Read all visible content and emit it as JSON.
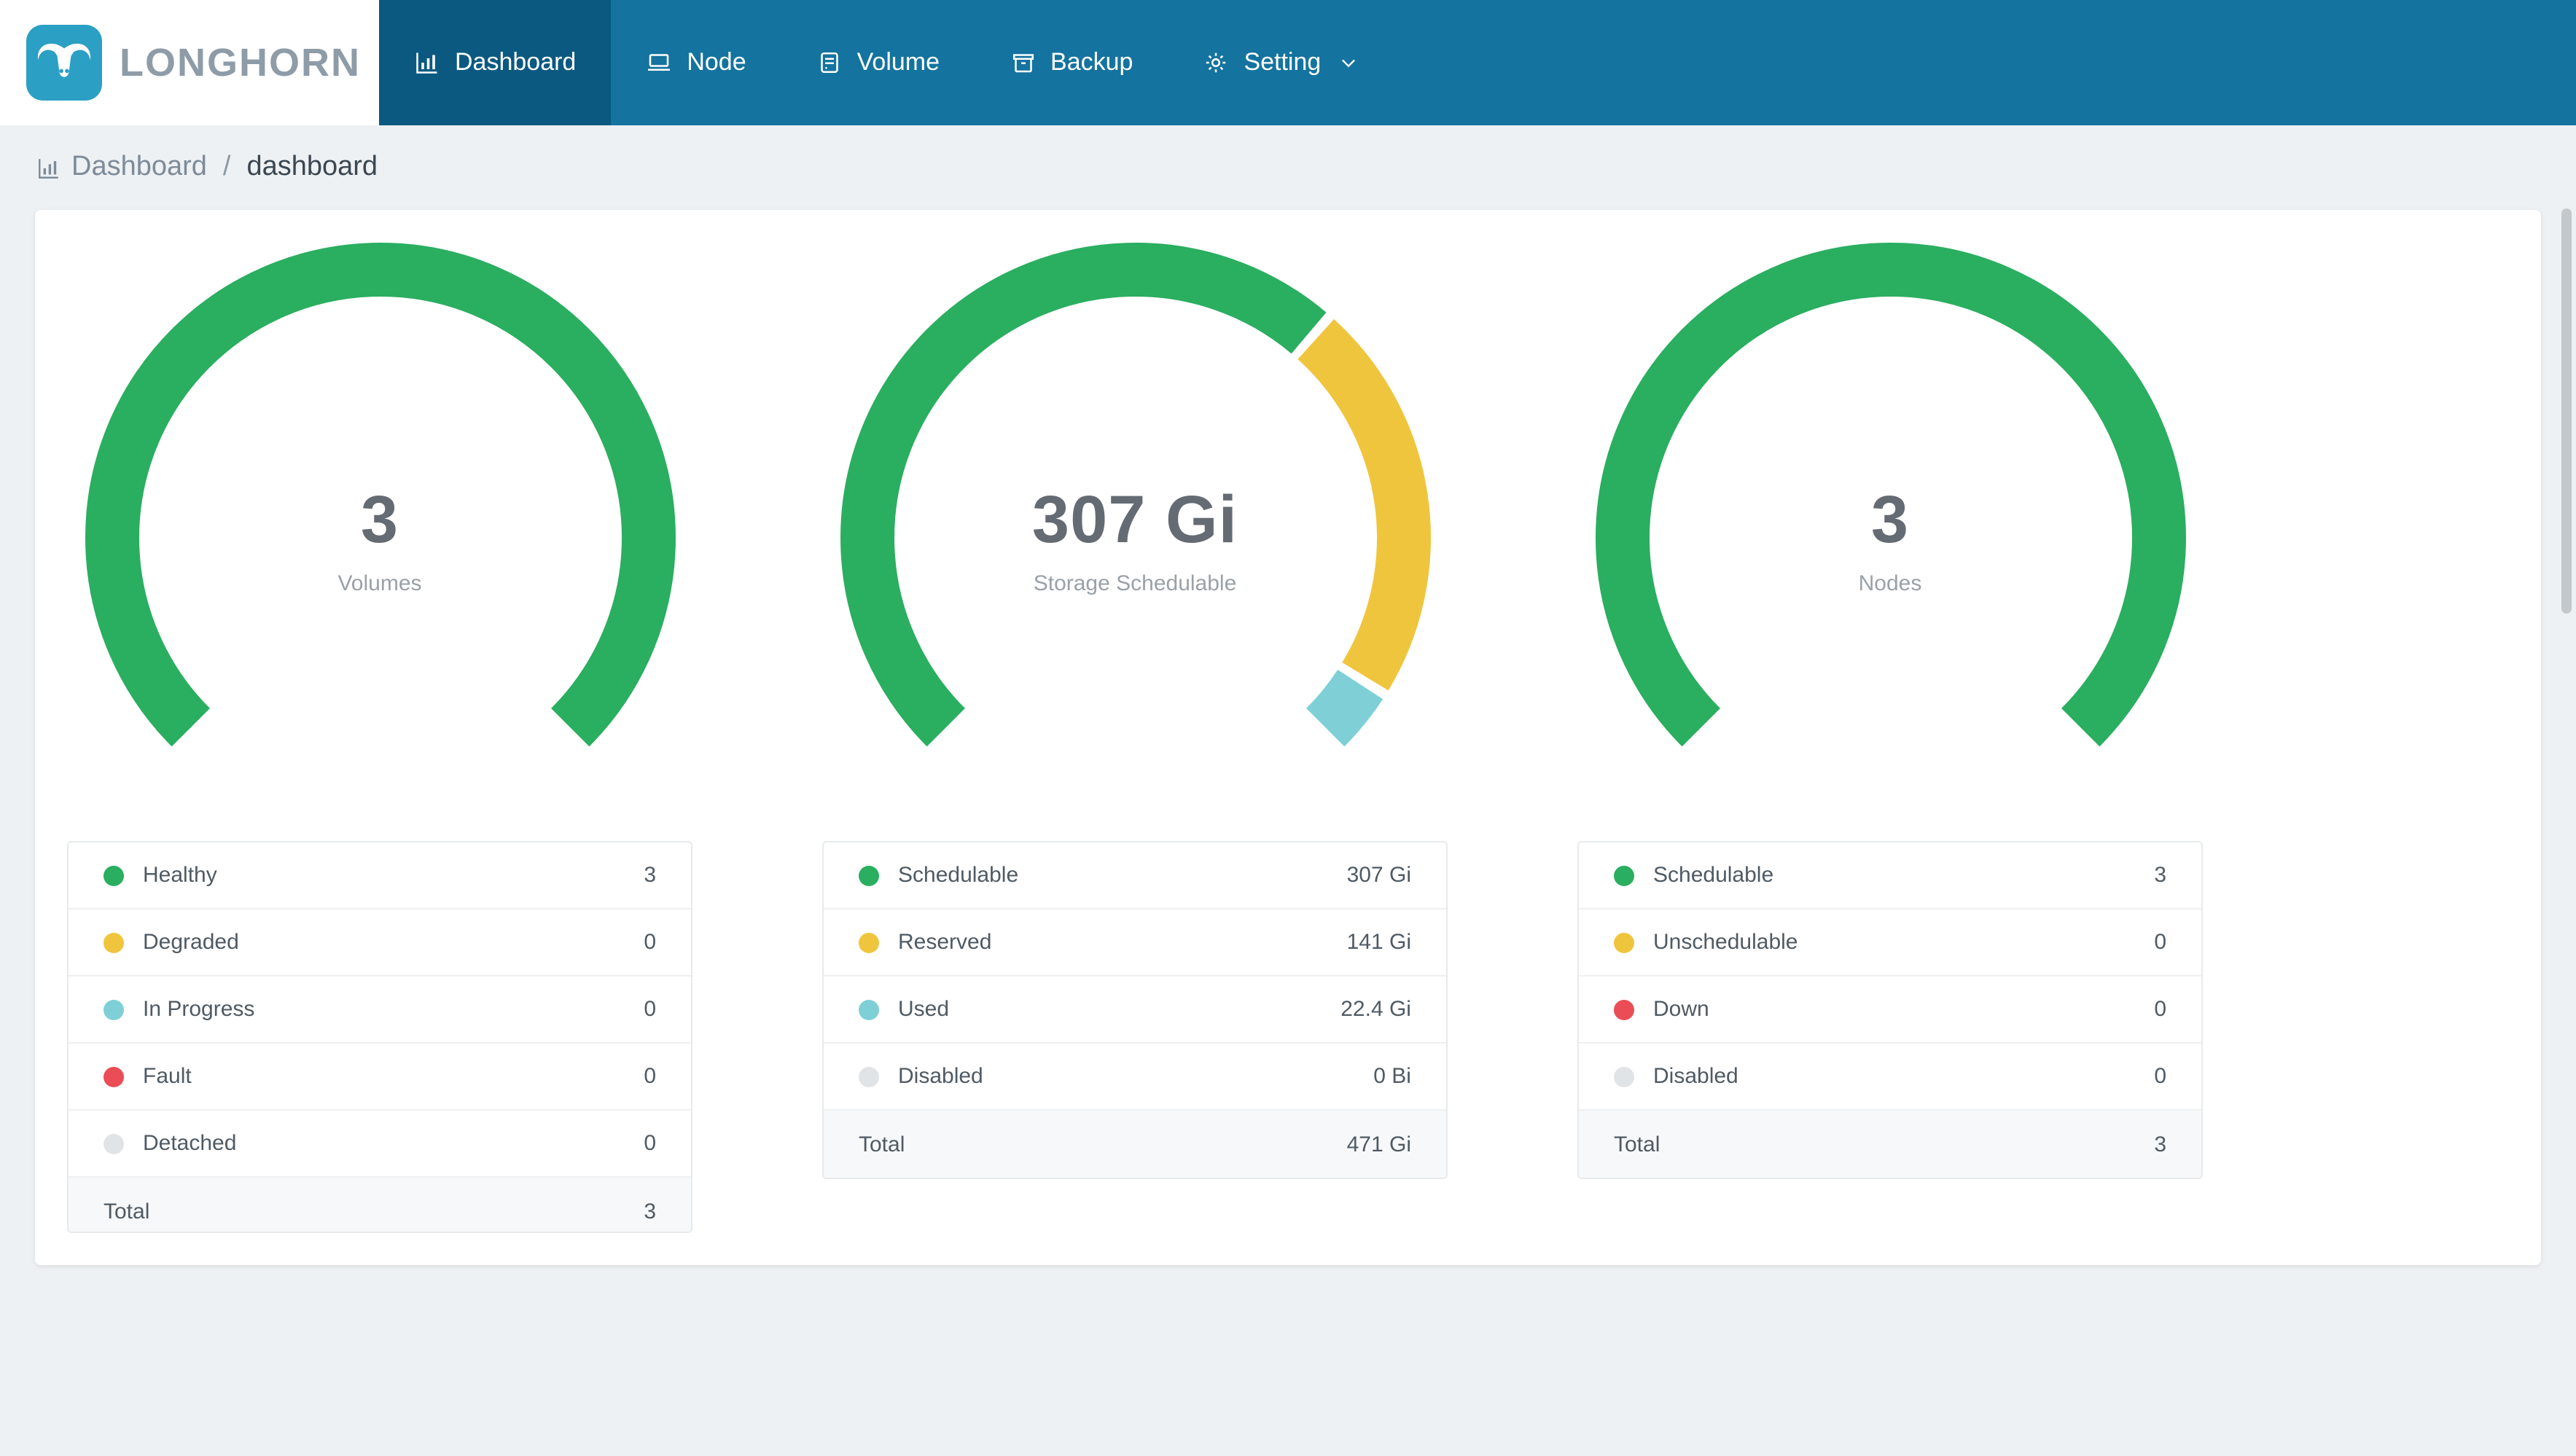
{
  "brand": {
    "name": "LONGHORN",
    "logo_color": "#2b9fc4",
    "text_color": "#8e9ca7"
  },
  "nav": {
    "background": "#14739f",
    "active_background": "#0b5981",
    "items": [
      {
        "label": "Dashboard",
        "icon": "bar-chart-icon",
        "active": true
      },
      {
        "label": "Node",
        "icon": "node-icon",
        "active": false
      },
      {
        "label": "Volume",
        "icon": "volume-icon",
        "active": false
      },
      {
        "label": "Backup",
        "icon": "backup-icon",
        "active": false
      },
      {
        "label": "Setting",
        "icon": "gear-icon",
        "active": false,
        "has_dropdown": true
      }
    ]
  },
  "breadcrumb": {
    "section": "Dashboard",
    "separator": "/",
    "page": "dashboard"
  },
  "colors": {
    "green": "#2aae60",
    "yellow": "#f0c53e",
    "teal": "#7ed0d6",
    "red": "#ea4d55",
    "gray": "#e0e4e7"
  },
  "chart_data": [
    {
      "type": "gauge-donut",
      "title": "Volumes",
      "center_value": "3",
      "center_label": "Volumes",
      "arc_sweep_degrees": 270,
      "segments": [
        {
          "name": "Healthy",
          "value": 3,
          "color": "#2aae60"
        }
      ]
    },
    {
      "type": "gauge-donut",
      "title": "Storage Schedulable",
      "center_value": "307 Gi",
      "center_label": "Storage Schedulable",
      "arc_sweep_degrees": 270,
      "segments": [
        {
          "name": "Schedulable",
          "value": 307,
          "color": "#2aae60"
        },
        {
          "name": "Reserved",
          "value": 141,
          "color": "#f0c53e"
        },
        {
          "name": "Used",
          "value": 22.4,
          "color": "#7ed0d6"
        }
      ]
    },
    {
      "type": "gauge-donut",
      "title": "Nodes",
      "center_value": "3",
      "center_label": "Nodes",
      "arc_sweep_degrees": 270,
      "segments": [
        {
          "name": "Schedulable",
          "value": 3,
          "color": "#2aae60"
        }
      ]
    }
  ],
  "panels": [
    {
      "center_value": "3",
      "center_label": "Volumes",
      "legend": [
        {
          "label": "Healthy",
          "value": "3",
          "color": "#2aae60"
        },
        {
          "label": "Degraded",
          "value": "0",
          "color": "#f0c53e"
        },
        {
          "label": "In Progress",
          "value": "0",
          "color": "#7ed0d6"
        },
        {
          "label": "Fault",
          "value": "0",
          "color": "#ea4d55"
        },
        {
          "label": "Detached",
          "value": "0",
          "color": "#e0e4e7"
        }
      ],
      "total_label": "Total",
      "total_value": "3"
    },
    {
      "center_value": "307 Gi",
      "center_label": "Storage Schedulable",
      "legend": [
        {
          "label": "Schedulable",
          "value": "307 Gi",
          "color": "#2aae60"
        },
        {
          "label": "Reserved",
          "value": "141 Gi",
          "color": "#f0c53e"
        },
        {
          "label": "Used",
          "value": "22.4 Gi",
          "color": "#7ed0d6"
        },
        {
          "label": "Disabled",
          "value": "0 Bi",
          "color": "#e0e4e7"
        }
      ],
      "total_label": "Total",
      "total_value": "471 Gi"
    },
    {
      "center_value": "3",
      "center_label": "Nodes",
      "legend": [
        {
          "label": "Schedulable",
          "value": "3",
          "color": "#2aae60"
        },
        {
          "label": "Unschedulable",
          "value": "0",
          "color": "#f0c53e"
        },
        {
          "label": "Down",
          "value": "0",
          "color": "#ea4d55"
        },
        {
          "label": "Disabled",
          "value": "0",
          "color": "#e0e4e7"
        }
      ],
      "total_label": "Total",
      "total_value": "3"
    }
  ]
}
